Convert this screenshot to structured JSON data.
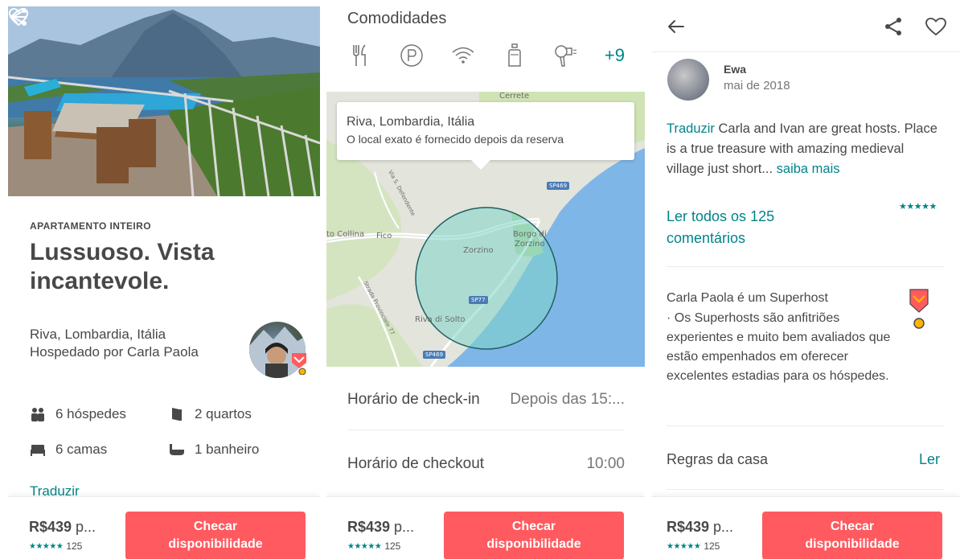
{
  "colors": {
    "accent": "#008489",
    "cta": "#ff5a5f",
    "text": "#484848",
    "muted": "#767676"
  },
  "listing": {
    "type_label": "APARTAMENTO INTEIRO",
    "title": "Lussuoso. Vista incantevole.",
    "location": "Riva, Lombardia, Itália",
    "host_line": "Hospedado por Carla Paola",
    "features": {
      "guests": "6 hóspedes",
      "bedrooms": "2 quartos",
      "beds": "6 camas",
      "bathrooms": "1 banheiro"
    },
    "translate": "Traduzir"
  },
  "booking_bar": {
    "price": "R$439",
    "price_suffix": " p...",
    "rating_stars": "★★★★★",
    "review_count": "125",
    "cta_line1": "Checar",
    "cta_line2": "disponibilidade"
  },
  "amenities": {
    "title": "Comodidades",
    "icons": [
      "cutlery-icon",
      "parking-icon",
      "wifi-icon",
      "bottle-icon",
      "hairdryer-icon"
    ],
    "more": "+9"
  },
  "map": {
    "tooltip_title": "Riva, Lombardia, Itália",
    "tooltip_sub": "O local exato é fornecido depois da reserva",
    "labels": {
      "cerrete": "Cerrete",
      "collina": "to Collina",
      "fico": "Fico",
      "zorzino": "Zorzino",
      "borgo": "Borgo di",
      "borgo2": "Zorzino",
      "riva": "Riva di Solto",
      "via": "Via S. Defendente",
      "strada": "Strada Provinciale 77"
    },
    "roads": {
      "sp469a": "SP469",
      "sp77": "SP77",
      "sp469b": "SP469"
    }
  },
  "details": {
    "checkin_label": "Horário de check-in",
    "checkin_value": "Depois das 15:...",
    "checkout_label": "Horário de checkout",
    "checkout_value": "10:00"
  },
  "review": {
    "name": "Ewa",
    "date": "mai de 2018",
    "translate": "Traduzir",
    "text": " Carla and Ivan are great hosts. Place is a true treasure with amazing medieval village just short... ",
    "more": "saiba mais",
    "read_all": "Ler todos os 125 comentários",
    "stars": "★★★★★"
  },
  "superhost": {
    "title": "Carla Paola é um Superhost",
    "text": "· Os Superhosts são anfitriões experientes e muito bem avaliados que estão empenhados em oferecer excelentes estadias para os hóspedes."
  },
  "rules": {
    "label": "Regras da casa",
    "link": "Ler"
  }
}
